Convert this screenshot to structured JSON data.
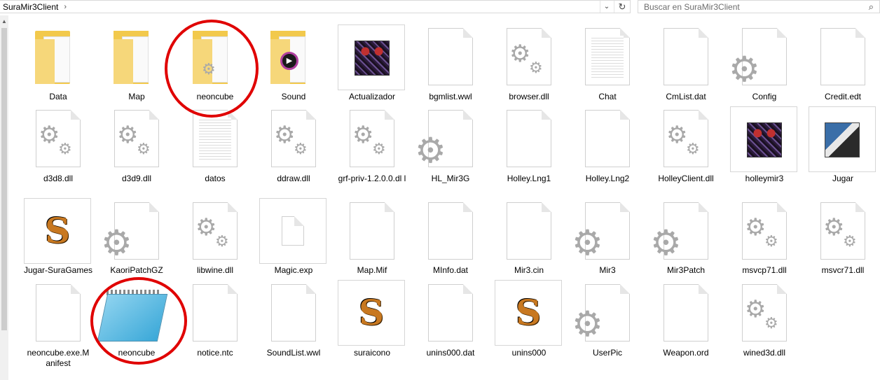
{
  "address": {
    "crumb": "SuraMir3Client",
    "chevron": "›"
  },
  "search": {
    "placeholder": "Buscar en SuraMir3Client"
  },
  "rows": [
    [
      "Data",
      "Map",
      "neoncube",
      "Sound",
      "Actualizador",
      "bgmlist.wwl",
      "browser.dll",
      "Chat",
      "CmList.dat",
      "Config",
      "Credit.edt"
    ],
    [
      "d3d8.dll",
      "d3d9.dll",
      "datos",
      "ddraw.dll",
      "grf-priv-1.2.0.0.dl l",
      "HL_Mir3G",
      "Holley.Lng1",
      "Holley.Lng2",
      "HolleyClient.dll",
      "holleymir3",
      "Jugar"
    ],
    [
      "Jugar-SuraGames",
      "KaoriPatchGZ",
      "libwine.dll",
      "Magic.exp",
      "Map.Mif",
      "MInfo.dat",
      "Mir3.cin",
      "Mir3",
      "Mir3Patch",
      "msvcp71.dll",
      "msvcr71.dll"
    ],
    [
      "neoncube.exe.M anifest",
      "neoncube",
      "notice.ntc",
      "SoundList.wwl",
      "suraicono",
      "unins000.dat",
      "unins000",
      "UserPic",
      "Weapon.ord",
      "wined3d.dll"
    ]
  ],
  "colors": {
    "highlight": "#e00000"
  }
}
